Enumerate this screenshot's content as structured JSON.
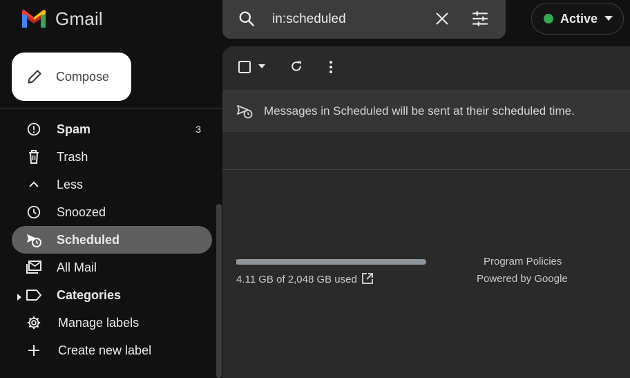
{
  "app": {
    "name": "Gmail"
  },
  "search": {
    "value": "in:scheduled"
  },
  "status": {
    "label": "Active",
    "color": "#34a853"
  },
  "compose": {
    "label": "Compose"
  },
  "nav": {
    "spam": {
      "label": "Spam",
      "count": "3",
      "icon": "report-icon"
    },
    "trash": {
      "label": "Trash",
      "icon": "trash-icon"
    },
    "less": {
      "label": "Less",
      "icon": "chevron-up-icon"
    },
    "snoozed": {
      "label": "Snoozed",
      "icon": "clock-icon"
    },
    "scheduled": {
      "label": "Scheduled",
      "icon": "scheduled-send-icon"
    },
    "all_mail": {
      "label": "All Mail",
      "icon": "all-mail-icon"
    },
    "categories": {
      "label": "Categories",
      "icon": "label-outline-icon"
    },
    "manage_labels": {
      "label": "Manage labels",
      "icon": "gear-icon"
    },
    "create_label": {
      "label": "Create new label",
      "icon": "plus-icon"
    }
  },
  "main": {
    "info_message": "Messages in Scheduled will be sent at their scheduled time.",
    "storage": {
      "text": "4.11 GB of 2,048 GB used",
      "fraction": 0.002
    },
    "footer": {
      "policies": "Program Policies",
      "powered": "Powered by Google"
    }
  },
  "colors": {
    "background": "#111111",
    "panel": "#2a2a2a",
    "active_item": "#5f5f5f",
    "search_bg": "#3c3c3c",
    "compose_bg": "#ffffff"
  }
}
